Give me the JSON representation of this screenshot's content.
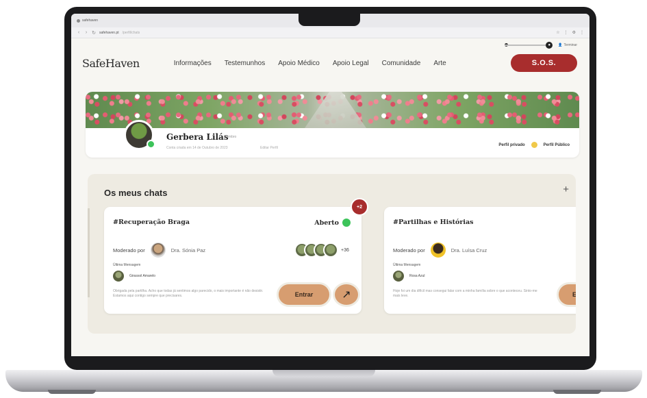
{
  "browser": {
    "tab_title": "safehaven",
    "url": "safehaven.pt",
    "url_rest": "/perfil/chats",
    "nav_back": "‹",
    "nav_forward": "›",
    "nav_reload": "↻",
    "addr_right": [
      "☆",
      "⋮",
      "⚙",
      "⋮"
    ]
  },
  "toolbar": {
    "user_link": "Terminar"
  },
  "header": {
    "logo": "SafeHaven",
    "nav": [
      "Informações",
      "Testemunhos",
      "Apoio Médico",
      "Apoio Legal",
      "Comunidade",
      "Arte"
    ],
    "sos": "S.O.S."
  },
  "profile": {
    "name": "Gerbera Lilás",
    "tag": "Membro",
    "subtitle": "Conta criada em 14 de Outubro de 2023",
    "subtitle2": "Editar Perfil",
    "right_private": "Perfil privado",
    "right_public": "Perfil Público"
  },
  "chats": {
    "title": "Os meus chats",
    "add_symbol": "+",
    "cards": [
      {
        "title": "#Recuperação Braga",
        "status": "Aberto",
        "badge": "+2",
        "moderated_label": "Moderado por",
        "moderator": "Dra. Sónia Paz",
        "participants_more": "+36",
        "last_message_label": "Última Mensagem",
        "last_author": "Girassol Amarelo",
        "snippet": "Obrigada pela partilha. Acho que todas já sentimos algo parecido, o mais importante é não desistir. Estamos aqui contigo sempre que precisares.",
        "enter": "Entrar",
        "arrow": "↗"
      },
      {
        "title": "#Partilhas e Histórias",
        "moderated_label": "Moderado por",
        "moderator": "Dra. Luísa Cruz",
        "last_message_label": "Última Mensagem",
        "last_author": "Rosa Azul",
        "snippet": "Hoje foi um dia difícil mas consegui falar com a minha família sobre o que aconteceu. Sinto-me mais leve.",
        "enter": "E"
      }
    ]
  },
  "colors": {
    "sos": "#a82d2d",
    "accent_button": "#d79d70",
    "online": "#3cc35a",
    "panel": "#eeebe2"
  }
}
